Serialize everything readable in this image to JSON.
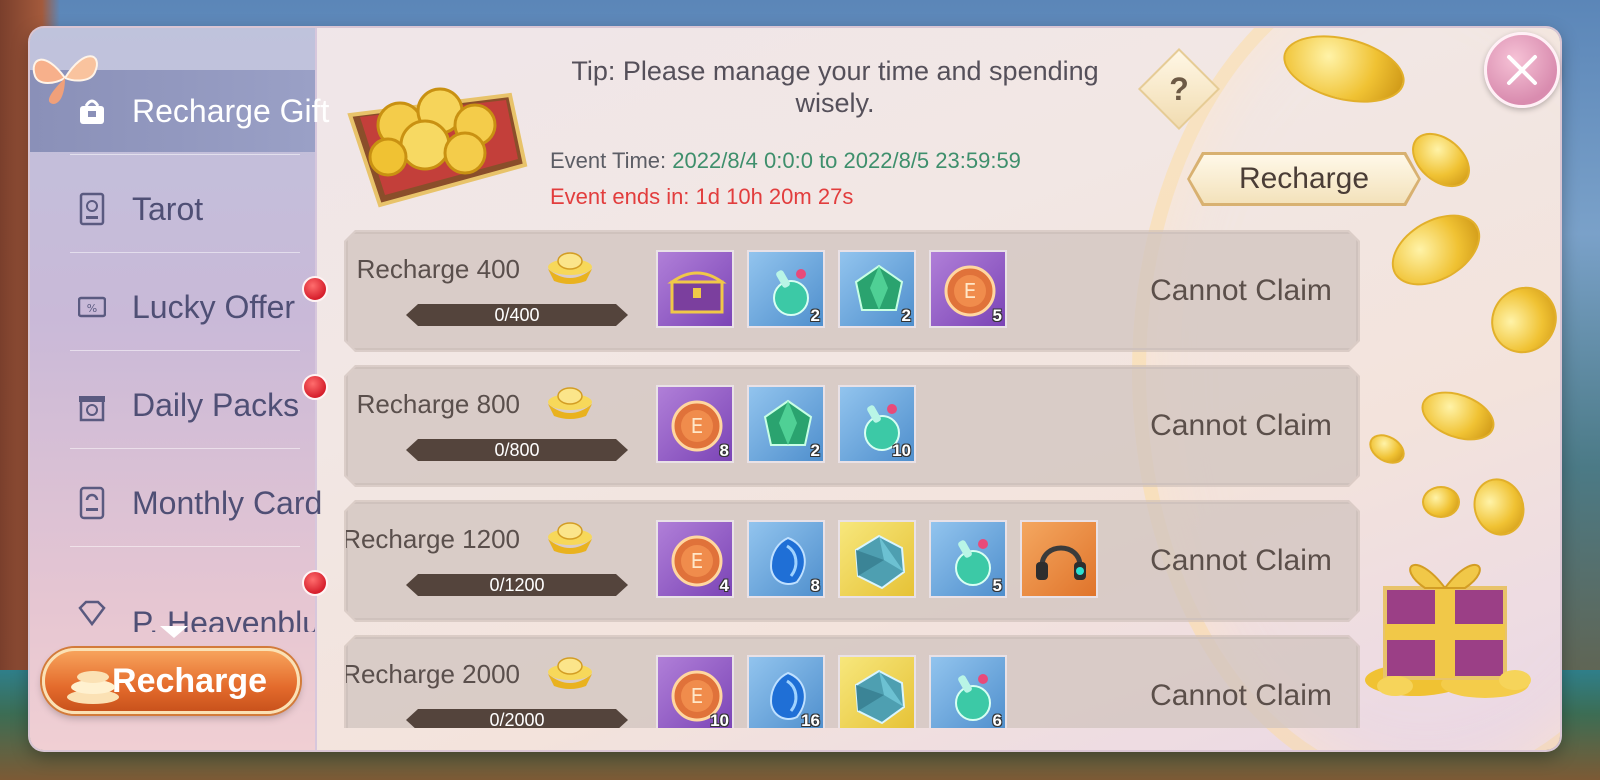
{
  "sidebar": {
    "items": [
      {
        "label": "Recharge Gift",
        "icon": "gift-bag-icon",
        "active": true,
        "dot": false
      },
      {
        "label": "Tarot",
        "icon": "tarot-card-icon",
        "active": false,
        "dot": false
      },
      {
        "label": "Lucky Offer",
        "icon": "discount-ticket-icon",
        "active": false,
        "dot": true
      },
      {
        "label": "Daily Packs",
        "icon": "gift-box-icon",
        "active": false,
        "dot": true
      },
      {
        "label": "Monthly Card",
        "icon": "monthly-card-icon",
        "active": false,
        "dot": false
      },
      {
        "label": "P. Heavenblue",
        "icon": "diamond-icon",
        "active": false,
        "dot": true
      }
    ],
    "recharge_label": "Recharge"
  },
  "header": {
    "tip": "Tip: Please manage your time and spending wisely.",
    "help_label": "?",
    "event_time_label": "Event Time: ",
    "event_time_value": "2022/8/4 0:0:0 to 2022/8/5 23:59:59",
    "event_ends": "Event ends in: 1d 10h 20m 27s",
    "recharge_label": "Recharge"
  },
  "rows": [
    {
      "title": "Recharge 400",
      "progress": "0/400",
      "progress_fraction": 0,
      "status": "Cannot Claim",
      "items": [
        {
          "icon": "treasure-chest-icon",
          "quality": "purple",
          "count": ""
        },
        {
          "icon": "potion-flask-icon",
          "quality": "blue",
          "count": "2"
        },
        {
          "icon": "green-crystal-icon",
          "quality": "blue",
          "count": "2"
        },
        {
          "icon": "exp-orb-icon",
          "quality": "purple",
          "count": "5"
        }
      ]
    },
    {
      "title": "Recharge 800",
      "progress": "0/800",
      "progress_fraction": 0,
      "status": "Cannot Claim",
      "items": [
        {
          "icon": "exp-orb-icon",
          "quality": "purple",
          "count": "8"
        },
        {
          "icon": "green-crystal-icon",
          "quality": "blue",
          "count": "2"
        },
        {
          "icon": "potion-flask-icon",
          "quality": "blue",
          "count": "10"
        }
      ]
    },
    {
      "title": "Recharge 1200",
      "progress": "0/1200",
      "progress_fraction": 0,
      "status": "Cannot Claim",
      "items": [
        {
          "icon": "exp-orb-icon",
          "quality": "purple",
          "count": "4"
        },
        {
          "icon": "blue-gem-icon",
          "quality": "blue",
          "count": "8"
        },
        {
          "icon": "ore-stone-icon",
          "quality": "yellow",
          "count": ""
        },
        {
          "icon": "potion-flask-icon",
          "quality": "blue",
          "count": "5"
        },
        {
          "icon": "headphones-icon",
          "quality": "orange",
          "count": ""
        }
      ]
    },
    {
      "title": "Recharge 2000",
      "progress": "0/2000",
      "progress_fraction": 0,
      "status": "Cannot Claim",
      "items": [
        {
          "icon": "exp-orb-icon",
          "quality": "purple",
          "count": "10"
        },
        {
          "icon": "blue-gem-icon",
          "quality": "blue",
          "count": "16"
        },
        {
          "icon": "ore-stone-icon",
          "quality": "yellow",
          "count": ""
        },
        {
          "icon": "potion-flask-icon",
          "quality": "blue",
          "count": "6"
        }
      ]
    }
  ],
  "colors": {
    "event_time_value": "#3e8f6c",
    "event_ends": "#e23d3d",
    "active_tab": "#8a90b8",
    "red_dot": "#d61f2c"
  }
}
